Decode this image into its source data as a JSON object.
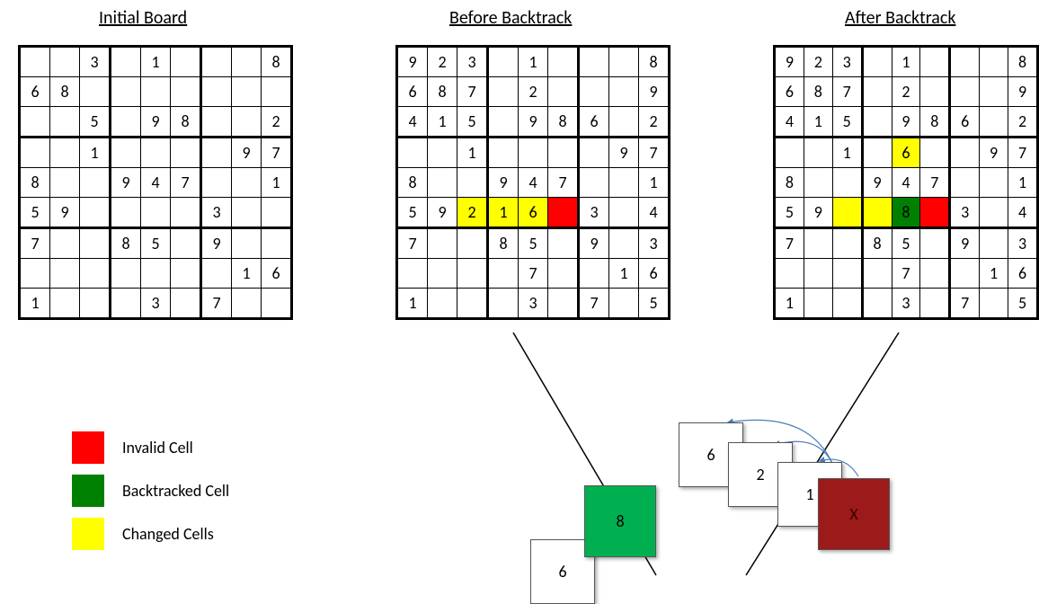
{
  "titles": {
    "initial": "Initial Board",
    "before": "Before Backtrack",
    "after": "After Backtrack"
  },
  "legend": {
    "invalid": "Invalid Cell",
    "backtracked": "Backtracked Cell",
    "changed": "Changed Cells"
  },
  "boards": {
    "initial": [
      [
        "",
        "",
        "3",
        "",
        "1",
        "",
        "",
        "",
        "8"
      ],
      [
        "6",
        "8",
        "",
        "",
        "",
        "",
        "",
        "",
        ""
      ],
      [
        "",
        "",
        "5",
        "",
        "9",
        "8",
        "",
        "",
        "2"
      ],
      [
        "",
        "",
        "1",
        "",
        "",
        "",
        "",
        "9",
        "7"
      ],
      [
        "8",
        "",
        "",
        "9",
        "4",
        "7",
        "",
        "",
        "1"
      ],
      [
        "5",
        "9",
        "",
        "",
        "",
        "",
        "3",
        "",
        ""
      ],
      [
        "7",
        "",
        "",
        "8",
        "5",
        "",
        "9",
        "",
        ""
      ],
      [
        "",
        "",
        "",
        "",
        "",
        "",
        "",
        "1",
        "6"
      ],
      [
        "1",
        "",
        "",
        "",
        "3",
        "",
        "7",
        "",
        ""
      ]
    ],
    "before": [
      [
        "9",
        "2",
        "3",
        "",
        "1",
        "",
        "",
        "",
        "8"
      ],
      [
        "6",
        "8",
        "7",
        "",
        "2",
        "",
        "",
        "",
        "9"
      ],
      [
        "4",
        "1",
        "5",
        "",
        "9",
        "8",
        "6",
        "",
        "2"
      ],
      [
        "",
        "",
        "1",
        "",
        "",
        "",
        "",
        "9",
        "7"
      ],
      [
        "8",
        "",
        "",
        "9",
        "4",
        "7",
        "",
        "",
        "1"
      ],
      [
        "5",
        "9",
        "2",
        "1",
        "6",
        "",
        "3",
        "",
        "4"
      ],
      [
        "7",
        "",
        "",
        "8",
        "5",
        "",
        "9",
        "",
        "3"
      ],
      [
        "",
        "",
        "",
        "",
        "7",
        "",
        "",
        "1",
        "6"
      ],
      [
        "1",
        "",
        "",
        "",
        "3",
        "",
        "7",
        "",
        "5"
      ]
    ],
    "after": [
      [
        "9",
        "2",
        "3",
        "",
        "1",
        "",
        "",
        "",
        "8"
      ],
      [
        "6",
        "8",
        "7",
        "",
        "2",
        "",
        "",
        "",
        "9"
      ],
      [
        "4",
        "1",
        "5",
        "",
        "9",
        "8",
        "6",
        "",
        "2"
      ],
      [
        "",
        "",
        "1",
        "",
        "6",
        "",
        "",
        "9",
        "7"
      ],
      [
        "8",
        "",
        "",
        "9",
        "4",
        "7",
        "",
        "",
        "1"
      ],
      [
        "5",
        "9",
        "",
        "",
        "8",
        "",
        "3",
        "",
        "4"
      ],
      [
        "7",
        "",
        "",
        "8",
        "5",
        "",
        "9",
        "",
        "3"
      ],
      [
        "",
        "",
        "",
        "",
        "7",
        "",
        "",
        "1",
        "6"
      ],
      [
        "1",
        "",
        "",
        "",
        "3",
        "",
        "7",
        "",
        "5"
      ]
    ]
  },
  "highlights": {
    "before": {
      "yellow": [
        [
          5,
          2
        ],
        [
          5,
          3
        ],
        [
          5,
          4
        ]
      ],
      "red": [
        [
          5,
          5
        ]
      ]
    },
    "after": {
      "yellow": [
        [
          3,
          4
        ],
        [
          5,
          2
        ],
        [
          5,
          3
        ]
      ],
      "green": [
        [
          5,
          4
        ]
      ],
      "red": [
        [
          5,
          5
        ]
      ]
    }
  },
  "stack_cards": {
    "c6a": "6",
    "c2": "2",
    "c1": "1",
    "c8": "8",
    "cx": "X",
    "c6b": "6"
  },
  "chart_data": {
    "type": "table",
    "description": "Three 9x9 Sudoku grids illustrating a backtracking step, plus a legend and a stack-of-cards diagram showing the sequence of tried values.",
    "boards": {
      "initial": [
        [
          "",
          "",
          "3",
          "",
          "1",
          "",
          "",
          "",
          "8"
        ],
        [
          "6",
          "8",
          "",
          "",
          "",
          "",
          "",
          "",
          ""
        ],
        [
          "",
          "",
          "5",
          "",
          "9",
          "8",
          "",
          "",
          "2"
        ],
        [
          "",
          "",
          "1",
          "",
          "",
          "",
          "",
          "9",
          "7"
        ],
        [
          "8",
          "",
          "",
          "9",
          "4",
          "7",
          "",
          "",
          "1"
        ],
        [
          "5",
          "9",
          "",
          "",
          "",
          "",
          "3",
          "",
          ""
        ],
        [
          "7",
          "",
          "",
          "8",
          "5",
          "",
          "9",
          "",
          ""
        ],
        [
          "",
          "",
          "",
          "",
          "",
          "",
          "",
          "1",
          "6"
        ],
        [
          "1",
          "",
          "",
          "",
          "3",
          "",
          "7",
          "",
          ""
        ]
      ],
      "before_backtrack": [
        [
          "9",
          "2",
          "3",
          "",
          "1",
          "",
          "",
          "",
          "8"
        ],
        [
          "6",
          "8",
          "7",
          "",
          "2",
          "",
          "",
          "",
          "9"
        ],
        [
          "4",
          "1",
          "5",
          "",
          "9",
          "8",
          "6",
          "",
          "2"
        ],
        [
          "",
          "",
          "1",
          "",
          "",
          "",
          "",
          "9",
          "7"
        ],
        [
          "8",
          "",
          "",
          "9",
          "4",
          "7",
          "",
          "",
          "1"
        ],
        [
          "5",
          "9",
          "2",
          "1",
          "6",
          "",
          "3",
          "",
          "4"
        ],
        [
          "7",
          "",
          "",
          "8",
          "5",
          "",
          "9",
          "",
          "3"
        ],
        [
          "",
          "",
          "",
          "",
          "7",
          "",
          "",
          "1",
          "6"
        ],
        [
          "1",
          "",
          "",
          "",
          "3",
          "",
          "7",
          "",
          "5"
        ]
      ],
      "after_backtrack": [
        [
          "9",
          "2",
          "3",
          "",
          "1",
          "",
          "",
          "",
          "8"
        ],
        [
          "6",
          "8",
          "7",
          "",
          "2",
          "",
          "",
          "",
          "9"
        ],
        [
          "4",
          "1",
          "5",
          "",
          "9",
          "8",
          "6",
          "",
          "2"
        ],
        [
          "",
          "",
          "1",
          "",
          "6",
          "",
          "",
          "9",
          "7"
        ],
        [
          "8",
          "",
          "",
          "9",
          "4",
          "7",
          "",
          "",
          "1"
        ],
        [
          "5",
          "9",
          "",
          "",
          "8",
          "",
          "3",
          "",
          "4"
        ],
        [
          "7",
          "",
          "",
          "8",
          "5",
          "",
          "9",
          "",
          "3"
        ],
        [
          "",
          "",
          "",
          "",
          "7",
          "",
          "",
          "1",
          "6"
        ],
        [
          "1",
          "",
          "",
          "",
          "3",
          "",
          "7",
          "",
          "5"
        ]
      ]
    },
    "highlights": {
      "before_backtrack": {
        "changed_cells_yellow": [
          [
            5,
            2
          ],
          [
            5,
            3
          ],
          [
            5,
            4
          ]
        ],
        "invalid_cell_red": [
          [
            5,
            5
          ]
        ]
      },
      "after_backtrack": {
        "changed_cells_yellow": [
          [
            3,
            4
          ],
          [
            5,
            2
          ],
          [
            5,
            3
          ]
        ],
        "backtracked_cell_green": [
          [
            5,
            4
          ]
        ],
        "invalid_cell_red": [
          [
            5,
            5
          ]
        ]
      }
    },
    "legend": {
      "red": "Invalid Cell",
      "green": "Backtracked Cell",
      "yellow": "Changed Cells"
    },
    "stack_sequence_top_to_bottom": [
      "6",
      "2",
      "1",
      "X"
    ],
    "stack_backtracked_value": "8",
    "stack_base_value": "6"
  }
}
